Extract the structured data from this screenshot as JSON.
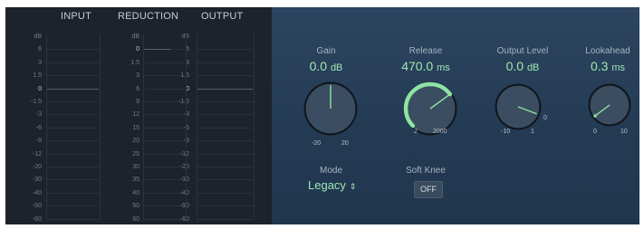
{
  "meters": {
    "headers": {
      "input": "INPUT",
      "reduction": "REDUCTION",
      "output": "OUTPUT"
    },
    "io_scale": [
      "dB",
      "6",
      "3",
      "1.5",
      "0",
      "-1.5",
      "-3",
      "-6",
      "-9",
      "-12",
      "-20",
      "-30",
      "-40",
      "-50",
      "-60"
    ],
    "reduction_scale": [
      "dB",
      "0",
      "1.5",
      "3",
      "6",
      "9",
      "12",
      "15",
      "20",
      "25",
      "30",
      "35",
      "40",
      "50",
      "60"
    ]
  },
  "knobs": {
    "gain": {
      "label": "Gain",
      "value": "0.0",
      "unit": "dB",
      "min": "-20",
      "max": "20",
      "fraction": 0.5
    },
    "release": {
      "label": "Release",
      "value": "470.0",
      "unit": "ms",
      "min": "2",
      "max": "2000",
      "fraction": 0.7
    },
    "output": {
      "label": "Output Level",
      "value": "0.0",
      "unit": "dB",
      "min": "-10",
      "max": "1",
      "extra_tick": "0",
      "fraction": 0.91
    },
    "lookahead": {
      "label": "Lookahead",
      "value": "0.3",
      "unit": "ms",
      "min": "0",
      "max": "10",
      "fraction": 0.03
    }
  },
  "mode": {
    "label": "Mode",
    "value": "Legacy"
  },
  "soft_knee": {
    "label": "Soft Knee",
    "value": "OFF"
  },
  "colors": {
    "accent": "#9fe6b2",
    "arc": "#8fe3a4",
    "panel": "#243b54",
    "meter_bg": "#1d232b"
  },
  "icons": {
    "mode_chevron": "up-down-chevron-icon"
  }
}
